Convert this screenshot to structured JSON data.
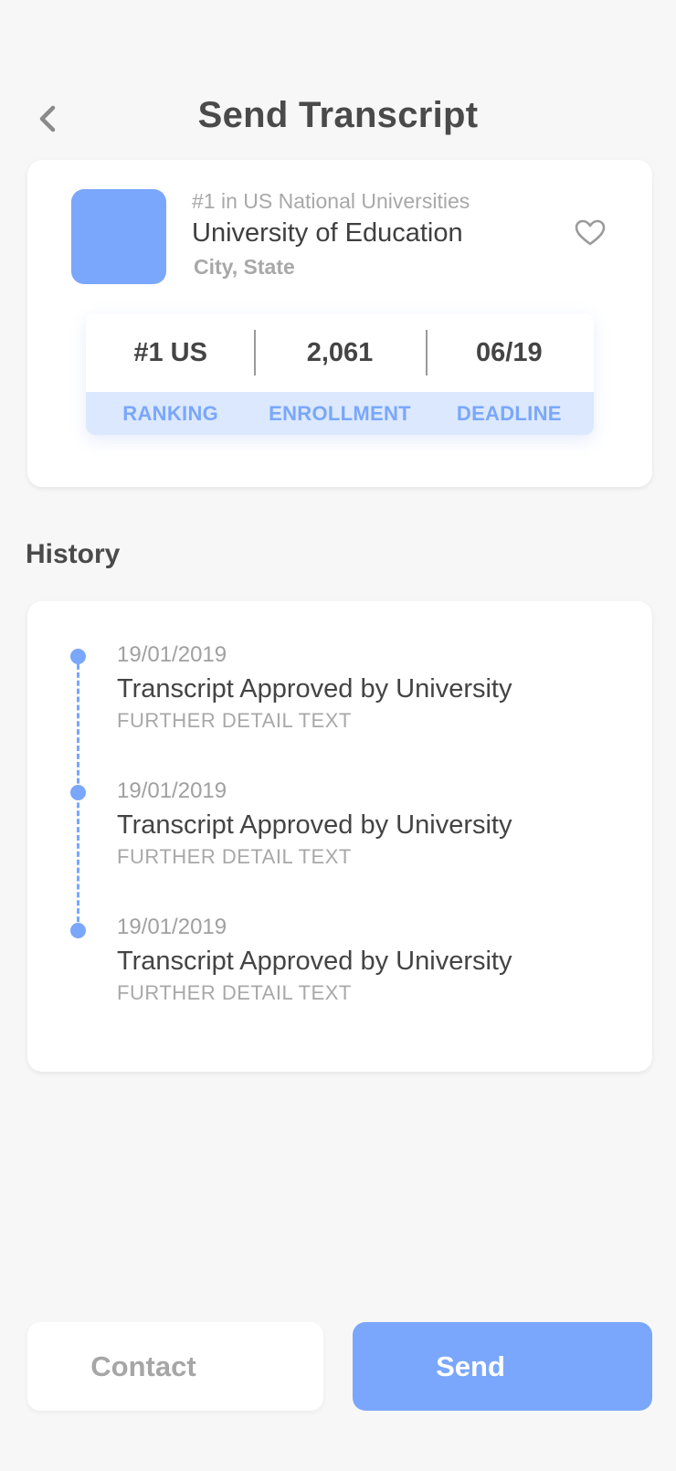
{
  "header": {
    "title": "Send Transcript",
    "back_icon": "chevron-left-icon"
  },
  "university": {
    "rank_line": "#1 in US National Universities",
    "name": "University of Education",
    "location": "City, State",
    "favorite_icon": "heart-outline-icon",
    "logo_color": "#7aa7fb",
    "stats": [
      {
        "value": "#1 US",
        "label": "RANKING"
      },
      {
        "value": "2,061",
        "label": "ENROLLMENT"
      },
      {
        "value": "06/19",
        "label": "DEADLINE"
      }
    ]
  },
  "history": {
    "title": "History",
    "items": [
      {
        "date": "19/01/2019",
        "text": "Transcript Approved by University",
        "detail": "FURTHER DETAIL TEXT"
      },
      {
        "date": "19/01/2019",
        "text": "Transcript Approved by University",
        "detail": "FURTHER DETAIL TEXT"
      },
      {
        "date": "19/01/2019",
        "text": "Transcript Approved by University",
        "detail": "FURTHER DETAIL TEXT"
      }
    ]
  },
  "actions": {
    "contact_label": "Contact",
    "send_label": "Send"
  },
  "colors": {
    "accent": "#7aa7fb",
    "label_bg": "#dbe8fe",
    "label_text": "#7aa7fb",
    "background": "#f7f7f7"
  }
}
